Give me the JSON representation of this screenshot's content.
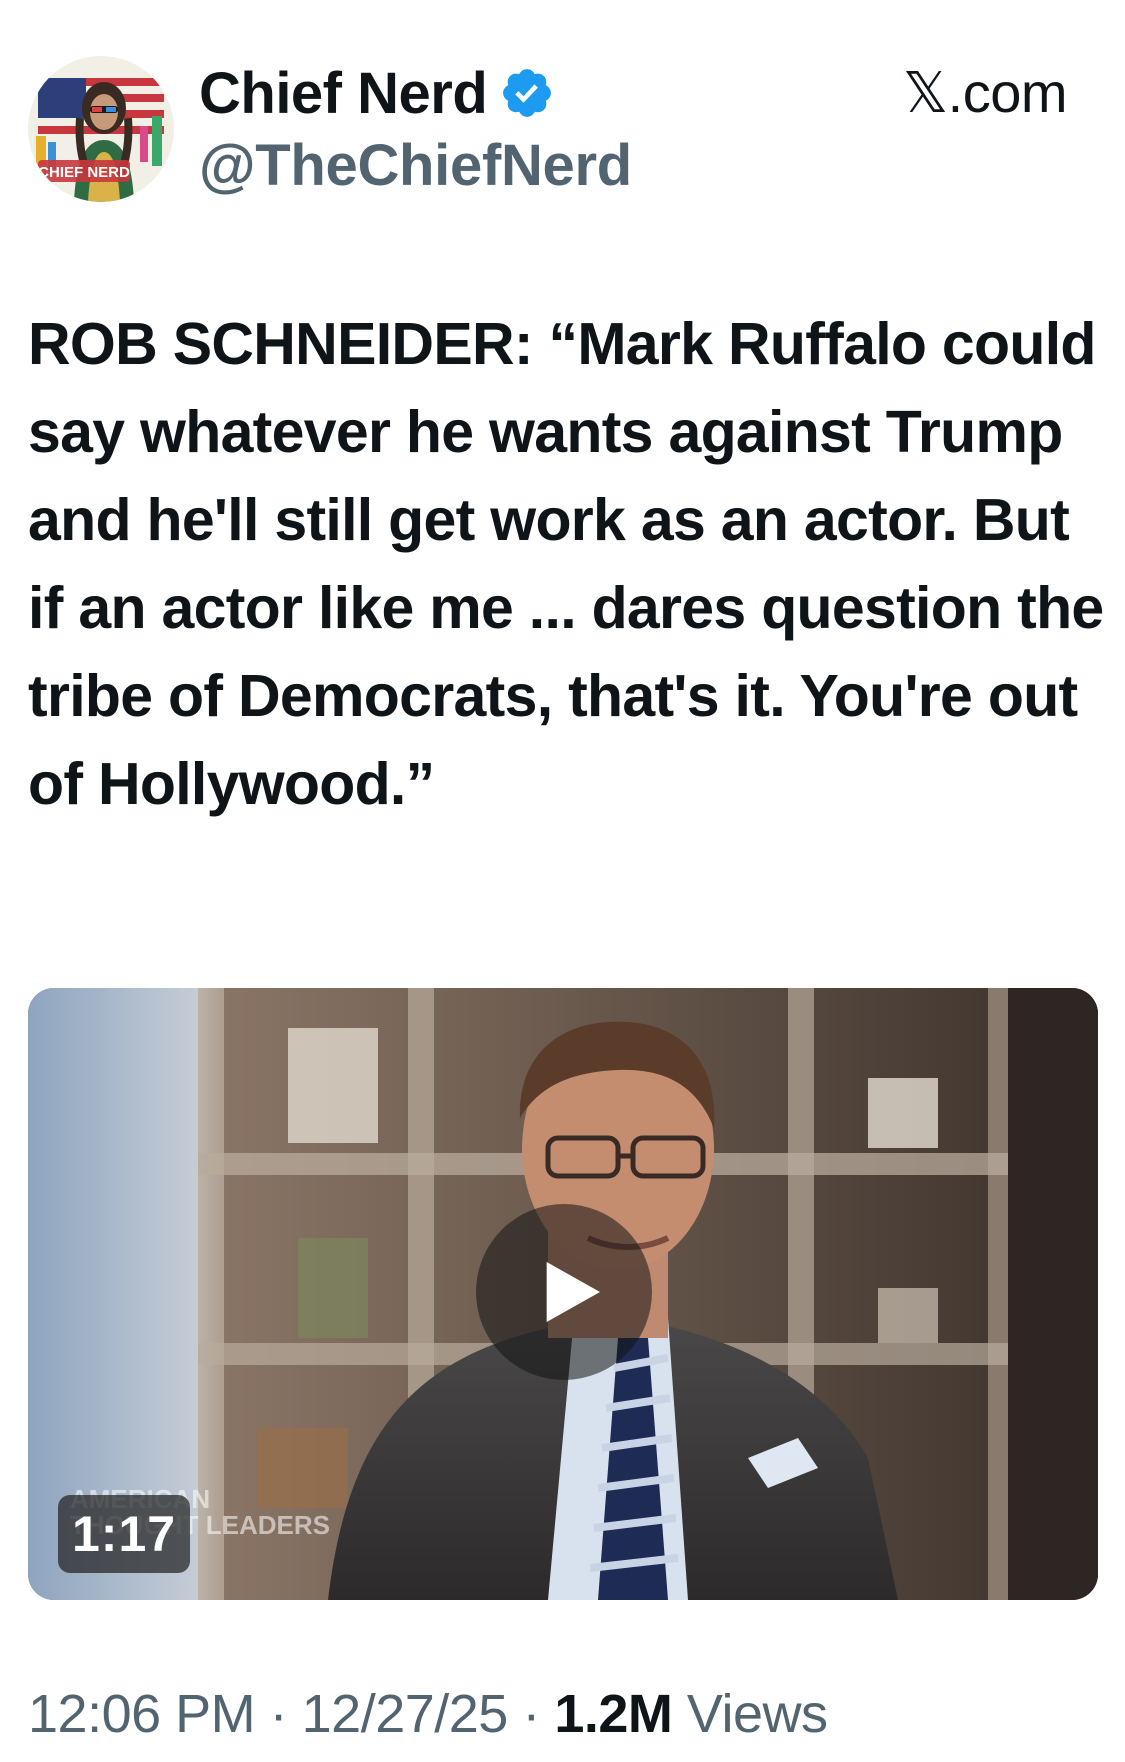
{
  "colors": {
    "text": "#0f1419",
    "secondary": "#536471",
    "verified_blue": "#1d9bf0"
  },
  "author": {
    "display_name": "Chief Nerd",
    "handle": "@TheChiefNerd",
    "verified": true,
    "verified_icon": "verified-badge-icon",
    "avatar_label": "CHIEF NERD"
  },
  "site": "𝕏.com",
  "tweet": {
    "text": "ROB SCHNEIDER: “Mark Ruffalo could say whatever he wants against Trump and he'll still get work as an actor. But if an actor like me ... dares question the tribe of Democrats, that's it. You're out of Hollywood.”"
  },
  "video": {
    "duration": "1:17",
    "watermark_line1": "AMERICAN",
    "watermark_line2": "THOUGHT LEADERS",
    "play_icon": "play-icon"
  },
  "meta": {
    "time": "12:06 PM",
    "separator": " · ",
    "date": "12/27/25",
    "views_count": "1.2M",
    "views_label": " Views"
  }
}
